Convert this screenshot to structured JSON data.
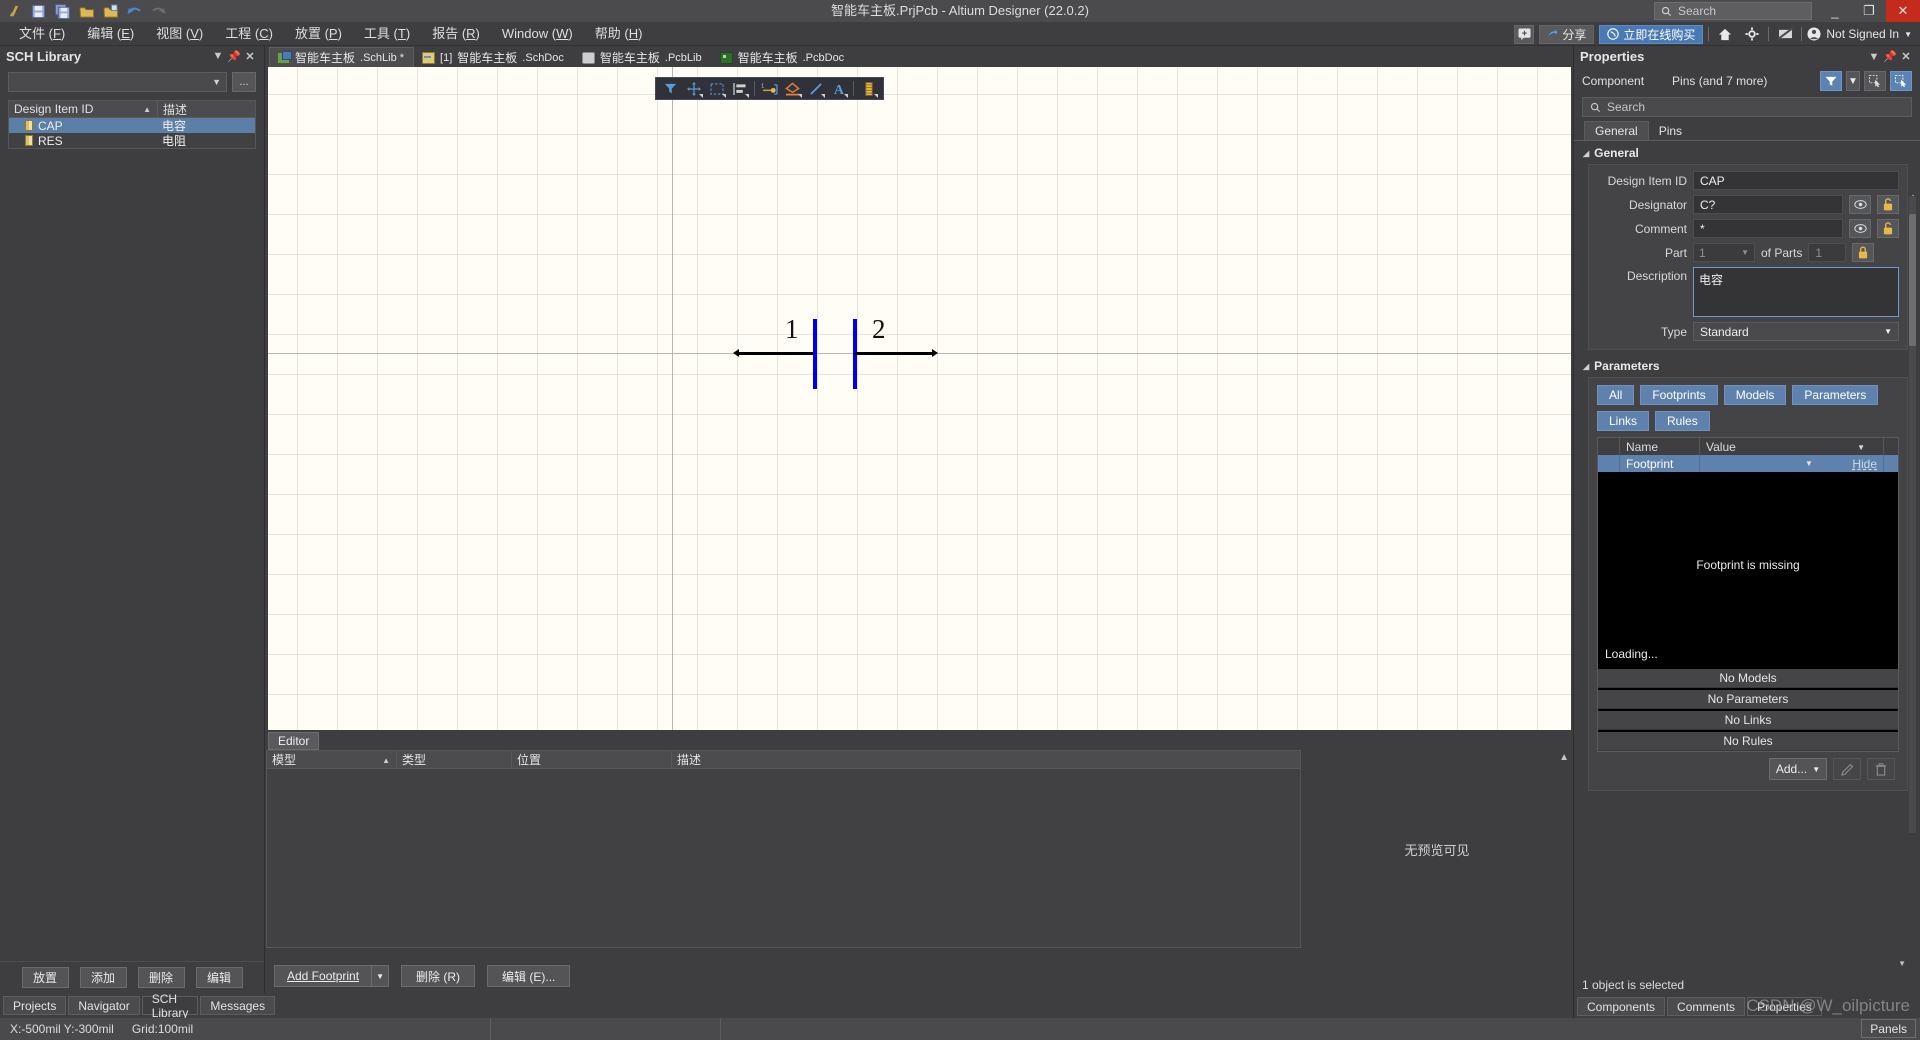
{
  "window": {
    "title": "智能车主板.PrjPcb - Altium Designer (22.0.2)",
    "search_placeholder": "Search",
    "minimize": "_",
    "restore": "❐",
    "close": "✕"
  },
  "quick_access": [
    {
      "name": "altium-logo-icon",
      "glyph": "∂"
    },
    {
      "name": "save-icon",
      "glyph": "▤"
    },
    {
      "name": "save-all-icon",
      "glyph": "▤"
    },
    {
      "name": "open-icon",
      "glyph": "▭"
    },
    {
      "name": "open-project-icon",
      "glyph": "▭"
    },
    {
      "name": "undo-icon",
      "glyph": "↩"
    },
    {
      "name": "redo-icon",
      "glyph": "↪"
    }
  ],
  "menu": [
    {
      "label": "文件",
      "accel": "F"
    },
    {
      "label": "编辑",
      "accel": "E"
    },
    {
      "label": "视图",
      "accel": "V"
    },
    {
      "label": "工程",
      "accel": "C"
    },
    {
      "label": "放置",
      "accel": "P"
    },
    {
      "label": "工具",
      "accel": "T"
    },
    {
      "label": "报告",
      "accel": "R"
    },
    {
      "label": "Window",
      "accel": "W"
    },
    {
      "label": "帮助",
      "accel": "H"
    }
  ],
  "menu_right": {
    "comment_label": "",
    "share_label": "分享",
    "buy_label": "立即在线购买",
    "signin_label": "Not Signed In"
  },
  "sch_library": {
    "title": "SCH Library",
    "filter_value": "",
    "ellipsis_label": "...",
    "columns": [
      "Design Item ID",
      "描述"
    ],
    "rows": [
      {
        "id": "CAP",
        "desc": "电容",
        "selected": true
      },
      {
        "id": "RES",
        "desc": "电阻",
        "selected": false
      }
    ],
    "buttons": [
      "放置",
      "添加",
      "删除",
      "编辑"
    ]
  },
  "left_tabs": [
    {
      "label": "Projects",
      "active": false
    },
    {
      "label": "Navigator",
      "active": false
    },
    {
      "label": "SCH Library",
      "active": true
    },
    {
      "label": "Messages",
      "active": false
    }
  ],
  "doc_tabs": [
    {
      "label": "智能车主板",
      "ext": ".SchLib *",
      "icon": "schlib-icon",
      "active": true,
      "prefix": ""
    },
    {
      "label": "智能车主板",
      "ext": ".SchDoc",
      "icon": "schdoc-icon",
      "active": false,
      "prefix": "[1] "
    },
    {
      "label": "智能车主板",
      "ext": ".PcbLib",
      "icon": "pcblib-icon",
      "active": false,
      "prefix": ""
    },
    {
      "label": "智能车主板",
      "ext": ".PcbDoc",
      "icon": "pcbdoc-icon",
      "active": false,
      "prefix": ""
    }
  ],
  "canvas_toolbar": [
    {
      "name": "filter-icon",
      "glyph": "▼"
    },
    {
      "name": "move-icon",
      "glyph": "✛"
    },
    {
      "name": "selection-icon",
      "glyph": "▭"
    },
    {
      "name": "align-icon",
      "glyph": "▤"
    },
    {
      "name": "place-pin-icon",
      "glyph": "⊶"
    },
    {
      "name": "place-polygon-icon",
      "glyph": "◇"
    },
    {
      "name": "place-line-icon",
      "glyph": "╱"
    },
    {
      "name": "place-text-icon",
      "glyph": "A"
    },
    {
      "name": "place-component-icon",
      "glyph": "▮"
    }
  ],
  "schematic": {
    "pin1_label": "1",
    "pin2_label": "2",
    "symbol_name": "capacitor-symbol",
    "wire_color": "#000000",
    "plate_color": "#0000e6",
    "background": "#fffdf5"
  },
  "editor_panel": {
    "tab_label": "Editor",
    "columns": [
      "模型",
      "类型",
      "位置",
      "描述"
    ],
    "rows": [],
    "no_preview": "无预览可见",
    "buttons": {
      "add_footprint": "Add Footprint",
      "delete": "删除 (R)",
      "edit": "编辑 (E)..."
    }
  },
  "properties": {
    "title": "Properties",
    "object_kind": "Component",
    "object_detail": "Pins (and 7 more)",
    "search_placeholder": "Search",
    "tabs": [
      {
        "label": "General",
        "active": true
      },
      {
        "label": "Pins",
        "active": false
      }
    ],
    "general": {
      "section_label": "General",
      "design_item_id_label": "Design Item ID",
      "design_item_id_value": "CAP",
      "designator_label": "Designator",
      "designator_value": "C?",
      "comment_label": "Comment",
      "comment_value": "*",
      "part_label": "Part",
      "part_value": "1",
      "of_parts_label": "of Parts",
      "of_parts_value": "1",
      "description_label": "Description",
      "description_value": "电容",
      "type_label": "Type",
      "type_value": "Standard"
    },
    "parameters": {
      "section_label": "Parameters",
      "chips": [
        "All",
        "Footprints",
        "Models",
        "Parameters",
        "Links",
        "Rules"
      ],
      "columns": [
        "Name",
        "Value"
      ],
      "row": {
        "name": "Footprint",
        "value": "",
        "hide_label": "Hide"
      },
      "preview_message": "Footprint is missing",
      "loading_message": "Loading...",
      "status_rows": [
        "No Models",
        "No Parameters",
        "No Links",
        "No Rules"
      ],
      "add_label": "Add...",
      "edit_icon": "pencil-icon",
      "delete_icon": "trash-icon"
    },
    "status": "1 object is selected",
    "bottom_tabs": [
      {
        "label": "Components",
        "active": false
      },
      {
        "label": "Comments",
        "active": false
      },
      {
        "label": "Properties",
        "active": true
      }
    ],
    "panels_label": "Panels"
  },
  "statusbar": {
    "coords": "X:-500mil Y:-300mil",
    "grid": "Grid:100mil"
  },
  "watermark": "CSDN @W_oilpicture",
  "colors": {
    "accent_blue": "#5e82ad",
    "window_bg": "#3e3e40",
    "canvas_bg": "#fffdf5",
    "close_red": "#c42b1c"
  }
}
